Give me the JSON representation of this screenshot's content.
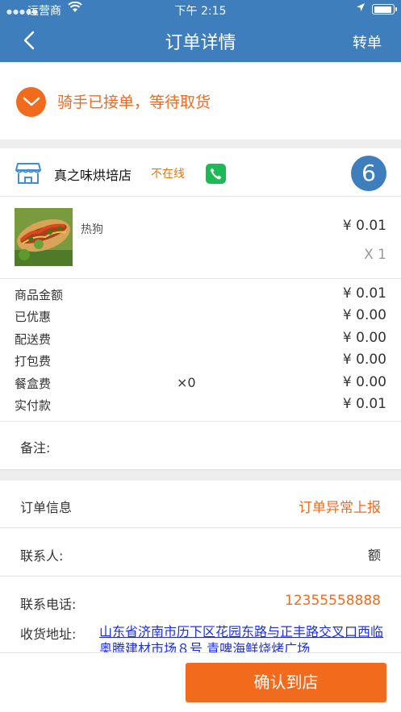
{
  "status_bar": {
    "carrier": "运营商",
    "time": "下午 2:15"
  },
  "nav": {
    "title": "订单详情",
    "transfer_label": "转单",
    "back_icon": "chevron-left-icon",
    "background_color": "#3f7ebd"
  },
  "order_status": {
    "text": "骑手已接单，等待取货",
    "color": "#f26b1d"
  },
  "store": {
    "name": "真之味烘培店",
    "online_status": "不在线",
    "order_number": "6"
  },
  "item": {
    "name": "热狗",
    "price": "¥ 0.01",
    "quantity": "X 1"
  },
  "fees": [
    {
      "label": "商品金额",
      "middle": "",
      "value": "¥ 0.01"
    },
    {
      "label": "已优惠",
      "middle": "",
      "value": "¥ 0.00"
    },
    {
      "label": "配送费",
      "middle": "",
      "value": "¥ 0.00"
    },
    {
      "label": "打包费",
      "middle": "",
      "value": "¥ 0.00"
    },
    {
      "label": "餐盒费",
      "middle": "×0",
      "value": "¥ 0.00"
    },
    {
      "label": "实付款",
      "middle": "",
      "value": "¥ 0.01"
    }
  ],
  "remark": {
    "label": "备注:"
  },
  "order_info": {
    "label": "订单信息",
    "report_link": "订单异常上报"
  },
  "contact": {
    "name_label": "联系人:",
    "name_value": "额",
    "phone_label": "联系电话:",
    "phone_value": "12355558888",
    "address_label": "收货地址:",
    "address_value": "山东省济南市历下区花园东路与正丰路交叉口西临奥腾建材市场８号 青啤海鲜烧烤广场"
  },
  "confirm_button": {
    "label": "确认到店"
  }
}
